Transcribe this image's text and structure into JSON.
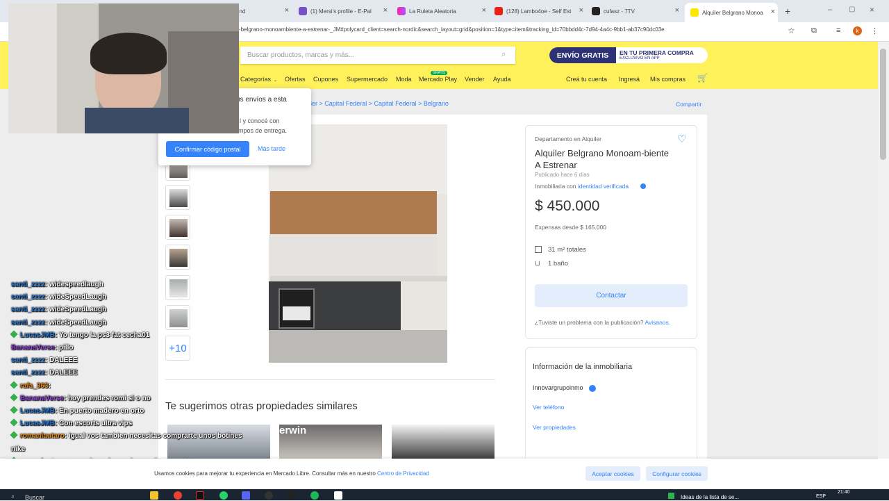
{
  "browser": {
    "tabs": [
      {
        "label": "und"
      },
      {
        "label": "(1) Mersi's profile - E-Pal"
      },
      {
        "label": "La Ruleta Aleatoria"
      },
      {
        "label": "(128) Lambo4oe - Self Est"
      },
      {
        "label": "cufasz - 7TV"
      },
      {
        "label": "Alquiler Belgrano Monoa"
      }
    ],
    "url": "-belgrano-monoambiente-a-estrenar-_JM#polycard_client=search-nordic&search_layout=grid&position=1&type=item&tracking_id=70bbdd4c-7d94-4a4c-9bb1-ab37c90dc03e",
    "profile_initial": "k"
  },
  "header": {
    "search_placeholder": "Buscar productos, marcas y más...",
    "promo_main": "ENVÍO GRATIS",
    "promo_line1": "EN TU PRIMERA COMPRA",
    "promo_line2": "EXCLUSIVO EN APP",
    "nav": [
      "Categorías",
      "Ofertas",
      "Cupones",
      "Supermercado",
      "Moda",
      "Mercado Play",
      "Vender",
      "Ayuda"
    ],
    "nuevo_badge": "GRATIS",
    "account": [
      "Creá tu cuenta",
      "Ingresá",
      "Mis compras"
    ]
  },
  "breadcrumb": "uiler  >  Capital Federal  >  Capital Federal  >  Belgrano",
  "share": "Compartir",
  "popup": {
    "title": "us envíos a esta",
    "text1": "l y conocé con",
    "text2": "mpos de entrega.",
    "confirm": "Confirmar código postal",
    "later": "Más tarde"
  },
  "gallery": {
    "more": "+10"
  },
  "listing": {
    "condition": "Departamento en Alquiler",
    "title": "Alquiler Belgrano Monoam-biente A Estrenar",
    "published": "Publicado hace 6 días",
    "seller_prefix": "Inmobiliaria con ",
    "seller_verified": "identidad verificada",
    "price": "$ 450.000",
    "expensas": "Expensas desde $ 165.000",
    "area": "31 m² totales",
    "baths": "1 baño",
    "contact": "Contactar",
    "problem_prefix": "¿Tuviste un problema con la publicación? ",
    "problem_link": "Avisanos."
  },
  "agency": {
    "heading": "Información de la inmobiliaria",
    "name": "Innovargrupoinmo",
    "phone_link": "Ver teléfono",
    "props_link": "Ver propiedades"
  },
  "similar": {
    "heading": "Te sugerimos otras propiedades similares",
    "card2_label": "erwin"
  },
  "chat": [
    {
      "user": "santi_zzzz",
      "msg": ": widespeedlaugh",
      "color": "u"
    },
    {
      "user": "santi_zzzz",
      "msg": ": wideSpeedLaugh",
      "color": "u"
    },
    {
      "user": "santi_zzzz",
      "msg": ": wideSpeedLaugh",
      "color": "u"
    },
    {
      "user": "santi_zzzz",
      "msg": ": wideSpeedLaugh",
      "color": "u"
    },
    {
      "user": "LucasJMB",
      "msg": ": Yo tengo la ps3 fat cecha01",
      "color": "u",
      "badge": true
    },
    {
      "user": "BananaVerse",
      "msg": ": pillo",
      "color": "p"
    },
    {
      "user": "santi_zzzz",
      "msg": ": DALEEE",
      "color": "u"
    },
    {
      "user": "santi_zzzz",
      "msg": ": DALEEE",
      "color": "u"
    },
    {
      "user": "rafa_363",
      "msg": ":",
      "color": "o",
      "badge": true
    },
    {
      "user": "BananaVerse",
      "msg": ": hoy prendes romi si o no",
      "color": "p",
      "badge": true
    },
    {
      "user": "LucasJMB",
      "msg": ": En puerto madero en orto",
      "color": "u",
      "badge": true
    },
    {
      "user": "LucasJMB",
      "msg": ": Con escorts ultra vips",
      "color": "u",
      "badge": true
    },
    {
      "user": "romanlautaro",
      "msg": ": igual vos tambien necesitas comprarte unos botines",
      "color": "o",
      "badge": true
    },
    {
      "user": "",
      "msg": "nike",
      "color": "u"
    },
    {
      "user": "romanlautaro",
      "msg": ": capaz la podemos hacer el mes q viene",
      "color": "o",
      "badge": true
    }
  ],
  "cookies": {
    "text": "Usamos cookies para mejorar tu experiencia en Mercado Libre. Consultar más en nuestro ",
    "link": "Centro de Privacidad",
    "accept": "Aceptar cookies",
    "configure": "Configurar cookies"
  },
  "taskbar": {
    "search": "Buscar",
    "news": "Ideas de la lista de se...",
    "lang": "ESP",
    "time": "21:40"
  },
  "colors": {
    "ml_yellow": "#fff159",
    "ml_blue": "#3483fa",
    "navy": "#2d3277"
  }
}
